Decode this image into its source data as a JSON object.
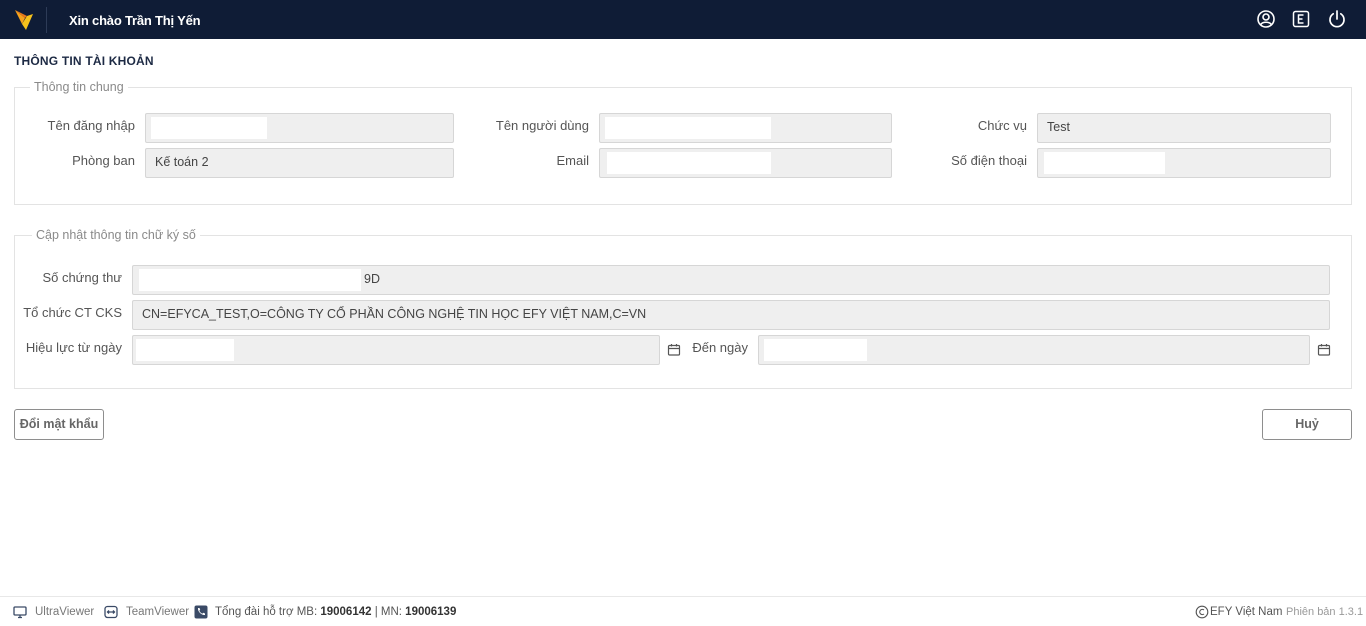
{
  "header": {
    "greeting": "Xin chào Trần Thị Yến",
    "icons": [
      "user-circle-icon",
      "e-letter-icon",
      "power-icon"
    ]
  },
  "page": {
    "title": "THÔNG TIN TÀI KHOẢN"
  },
  "general": {
    "legend": "Thông tin chung",
    "username_label": "Tên đăng nhập",
    "username_value": "",
    "fullname_label": "Tên người dùng",
    "fullname_value": "",
    "position_label": "Chức vụ",
    "position_value": "Test",
    "department_label": "Phòng ban",
    "department_value": "Kế toán 2",
    "email_label": "Email",
    "email_value": "",
    "phone_label": "Số điện thoại",
    "phone_value": ""
  },
  "signature": {
    "legend": "Cập nhật thông tin chữ ký số",
    "cert_label": "Số chứng thư",
    "cert_value": "9D",
    "issuer_label": "Tổ chức CT CKS",
    "issuer_value": "CN=EFYCA_TEST,O=CÔNG TY CỔ PHẦN CÔNG NGHỆ TIN HỌC EFY VIỆT NAM,C=VN",
    "valid_from_label": "Hiệu lực từ ngày",
    "valid_from_value": "",
    "valid_to_label": "Đến ngày",
    "valid_to_value": ""
  },
  "actions": {
    "change_password": "Đổi mật khẩu",
    "cancel": "Huỷ"
  },
  "footer": {
    "ultraviewer": "UltraViewer",
    "teamviewer": "TeamViewer",
    "hotline_prefix": "Tổng đài hỗ trợ MB: ",
    "hotline_mb": "19006142",
    "hotline_sep": " | MN: ",
    "hotline_mn": "19006139",
    "company": "EFY Việt Nam",
    "version": "Phiên bản 1.3.1"
  }
}
